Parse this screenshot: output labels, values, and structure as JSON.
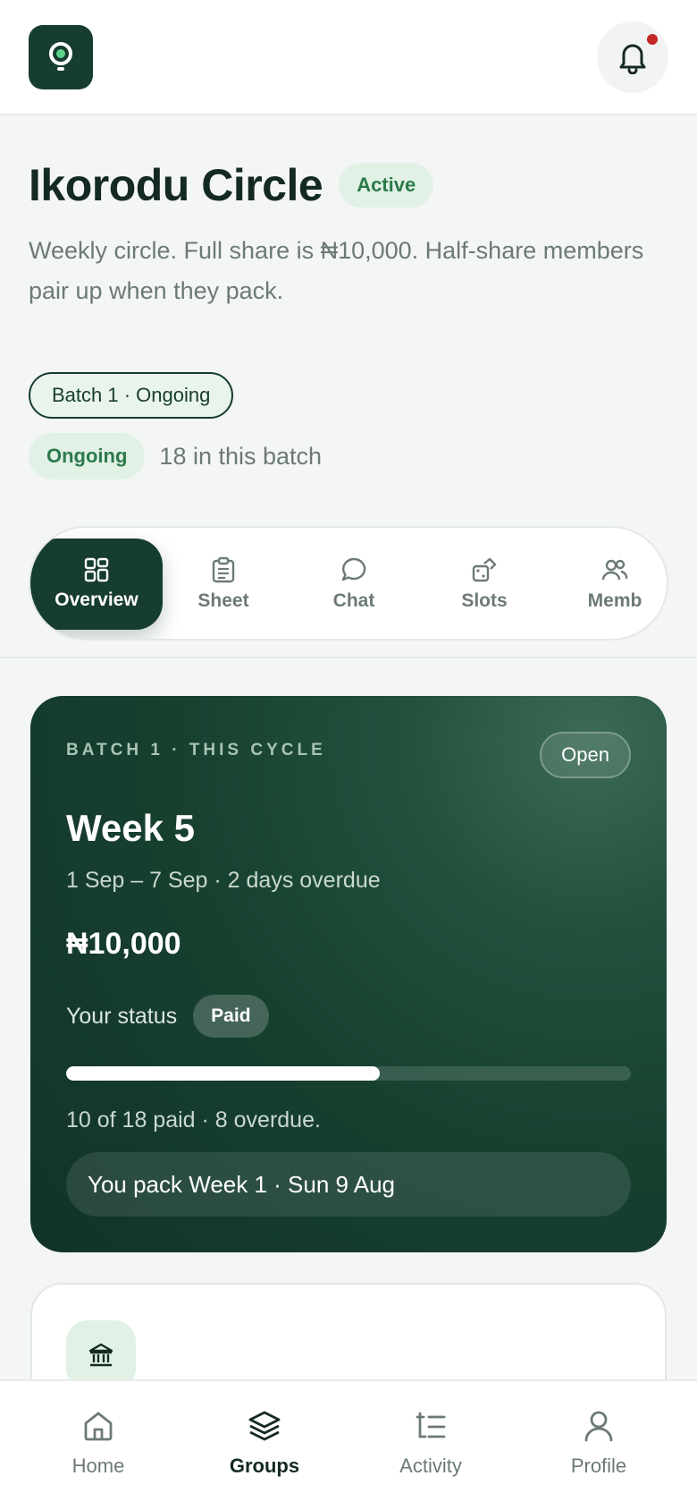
{
  "header": {
    "logo_icon": "app-logo-icon",
    "notification_icon": "bell-icon",
    "has_notification": true
  },
  "group": {
    "title": "Ikorodu Circle",
    "status": "Active",
    "description": "Weekly circle. Full share is ₦10,000. Half-share members pair up when they pack.",
    "batch_chip": "Batch 1 · Ongoing",
    "batch_status": "Ongoing",
    "batch_count": "18 in this batch"
  },
  "tabs": [
    {
      "label": "Overview",
      "icon": "grid-icon",
      "active": true
    },
    {
      "label": "Sheet",
      "icon": "clipboard-icon",
      "active": false
    },
    {
      "label": "Chat",
      "icon": "chat-bubble-icon",
      "active": false
    },
    {
      "label": "Slots",
      "icon": "slots-icon",
      "active": false
    },
    {
      "label": "Memb",
      "icon": "members-icon",
      "active": false
    }
  ],
  "cycle_card": {
    "label": "BATCH 1 · THIS CYCLE",
    "state": "Open",
    "week": "Week 5",
    "dates": "1 Sep – 7 Sep · 2 days overdue",
    "amount": "₦10,000",
    "status_label": "Your status",
    "status_value": "Paid",
    "paid_count": 10,
    "total_count": 18,
    "paid_summary": "10 of 18 paid · 8 overdue.",
    "pack_note": "You pack Week 1 · Sun 9 Aug"
  },
  "next_card": {
    "icon": "bank-icon"
  },
  "bottom_nav": [
    {
      "label": "Home",
      "icon": "home-icon",
      "active": false
    },
    {
      "label": "Groups",
      "icon": "layers-icon",
      "active": true
    },
    {
      "label": "Activity",
      "icon": "activity-list-icon",
      "active": false
    },
    {
      "label": "Profile",
      "icon": "user-icon",
      "active": false
    }
  ],
  "colors": {
    "brand_dark": "#163d2d",
    "accent_green": "#2b7a4b",
    "alert_red": "#c62828"
  }
}
